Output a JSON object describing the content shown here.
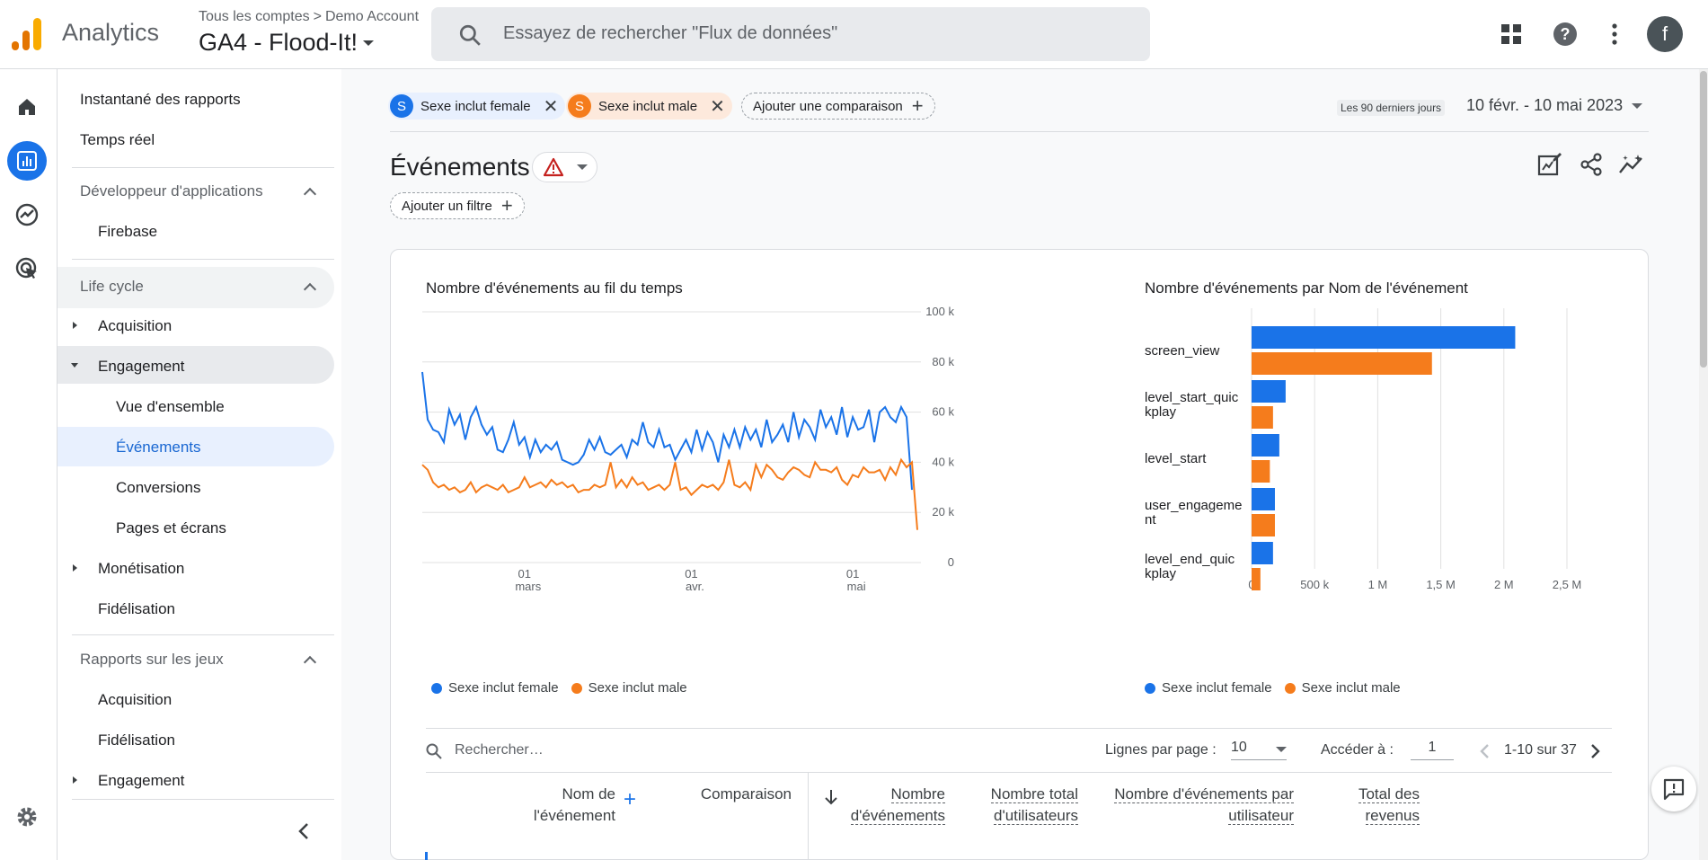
{
  "header": {
    "app_name": "Analytics",
    "breadcrumb_root": "Tous les comptes",
    "breadcrumb_sep": ">",
    "breadcrumb_account": "Demo Account",
    "property": "GA4 - Flood-It!",
    "search_placeholder": "Essayez de rechercher \"Flux de données\"",
    "avatar_letter": "f"
  },
  "nav": {
    "items": [
      {
        "label": "Instantané des rapports"
      },
      {
        "label": "Temps réel"
      },
      {
        "label": "Développeur d'applications"
      },
      {
        "label": "Firebase"
      },
      {
        "label": "Life cycle"
      },
      {
        "label": "Acquisition"
      },
      {
        "label": "Engagement"
      },
      {
        "label": "Vue d'ensemble"
      },
      {
        "label": "Événements"
      },
      {
        "label": "Conversions"
      },
      {
        "label": "Pages et écrans"
      },
      {
        "label": "Monétisation"
      },
      {
        "label": "Fidélisation"
      },
      {
        "label": "Rapports sur les jeux"
      },
      {
        "label": "Acquisition"
      },
      {
        "label": "Fidélisation"
      },
      {
        "label": "Engagement"
      }
    ]
  },
  "comparisons": {
    "chip1_badge": "S",
    "chip1_label": "Sexe inclut female",
    "chip2_badge": "S",
    "chip2_label": "Sexe inclut male",
    "add_label": "Ajouter une comparaison"
  },
  "date": {
    "period_label": "Les 90 derniers jours",
    "range": "10 févr. - 10 mai 2023"
  },
  "page": {
    "title": "Événements",
    "add_filter": "Ajouter un filtre"
  },
  "colors": {
    "female": "#1a73e8",
    "male": "#f57c1c",
    "accent": "#1a73e8"
  },
  "chart_data": [
    {
      "type": "line",
      "title": "Nombre d'événements au fil du temps",
      "ylim": [
        0,
        100000
      ],
      "y_ticks": [
        "100 k",
        "80 k",
        "60 k",
        "40 k",
        "20 k",
        "0"
      ],
      "x_ticks": [
        {
          "day": "01",
          "month": "mars"
        },
        {
          "day": "01",
          "month": "avr."
        },
        {
          "day": "01",
          "month": "mai"
        }
      ],
      "series": [
        {
          "name": "Sexe inclut female",
          "values": [
            76000,
            57000,
            53000,
            52000,
            48000,
            61000,
            55000,
            59000,
            49000,
            58000,
            62000,
            55000,
            51000,
            54000,
            45000,
            44000,
            49000,
            56000,
            47000,
            50000,
            42000,
            49000,
            44000,
            47000,
            45000,
            48000,
            41000,
            40000,
            39000,
            40000,
            43000,
            49000,
            45000,
            50000,
            44000,
            43000,
            45000,
            47000,
            42000,
            49000,
            47000,
            56000,
            48000,
            46000,
            53000,
            46000,
            47000,
            41000,
            45000,
            49000,
            44000,
            53000,
            45000,
            52000,
            48000,
            40000,
            51000,
            46000,
            53000,
            46000,
            54000,
            49000,
            53000,
            46000,
            57000,
            48000,
            51000,
            55000,
            48000,
            60000,
            50000,
            57000,
            54000,
            49000,
            61000,
            54000,
            58000,
            51000,
            62000,
            50000,
            58000,
            53000,
            54000,
            61000,
            48000,
            60000,
            62000,
            58000,
            56000,
            62000,
            58000,
            29000
          ]
        },
        {
          "name": "Sexe inclut male",
          "values": [
            39000,
            37000,
            32000,
            30000,
            31000,
            29000,
            30000,
            28000,
            29000,
            32000,
            28000,
            30000,
            31000,
            30000,
            29000,
            31000,
            28000,
            29000,
            30000,
            34000,
            30000,
            31000,
            32000,
            30000,
            33000,
            31000,
            32000,
            30000,
            31000,
            28000,
            29000,
            29000,
            31000,
            30000,
            31000,
            40000,
            30000,
            33000,
            30000,
            34000,
            31000,
            32000,
            29000,
            30000,
            31000,
            29000,
            31000,
            40000,
            29000,
            30000,
            27000,
            29000,
            31000,
            30000,
            31000,
            29000,
            32000,
            41000,
            31000,
            30000,
            32000,
            29000,
            39000,
            34000,
            39000,
            37000,
            34000,
            33000,
            36000,
            38000,
            37000,
            35000,
            34000,
            40000,
            37000,
            37000,
            36000,
            38000,
            33000,
            31000,
            35000,
            34000,
            38000,
            36000,
            36000,
            37000,
            33000,
            38000,
            35000,
            41000,
            38000,
            40000,
            13000
          ]
        }
      ]
    },
    {
      "type": "bar",
      "title": "Nombre d'événements par Nom de l'événement",
      "categories": [
        "screen_view",
        "level_start_quickplay",
        "level_start",
        "user_engagement",
        "level_end_quickplay"
      ],
      "category_lines": [
        [
          "screen_view"
        ],
        [
          "level_start_quic",
          "kplay"
        ],
        [
          "level_start"
        ],
        [
          "user_engageme",
          "nt"
        ],
        [
          "level_end_quic",
          "kplay"
        ]
      ],
      "x_ticks": [
        "0",
        "500 k",
        "1 M",
        "1,5 M",
        "2 M",
        "2,5 M"
      ],
      "xlim": [
        0,
        2500000
      ],
      "series": [
        {
          "name": "Sexe inclut female",
          "values": [
            2090000,
            270000,
            220000,
            185000,
            170000
          ]
        },
        {
          "name": "Sexe inclut male",
          "values": [
            1430000,
            170000,
            145000,
            185000,
            70000
          ]
        }
      ]
    }
  ],
  "legend": {
    "female": "Sexe inclut female",
    "male": "Sexe inclut male"
  },
  "table": {
    "search_placeholder": "Rechercher…",
    "rows_per_page_label": "Lignes par page :",
    "rows_per_page": "10",
    "goto_label": "Accéder à :",
    "goto_value": "1",
    "range": "1-10 sur 37",
    "col_event_1": "Nom de",
    "col_event_2": "l'événement",
    "col_compare": "Comparaison",
    "col_events_1": "Nombre",
    "col_events_2": "d'événements",
    "col_users_1": "Nombre total",
    "col_users_2": "d'utilisateurs",
    "col_per_user": "Nombre d'événements par",
    "col_per_user_2": "utilisateur",
    "col_revenue_1": "Total des",
    "col_revenue_2": "revenus"
  }
}
